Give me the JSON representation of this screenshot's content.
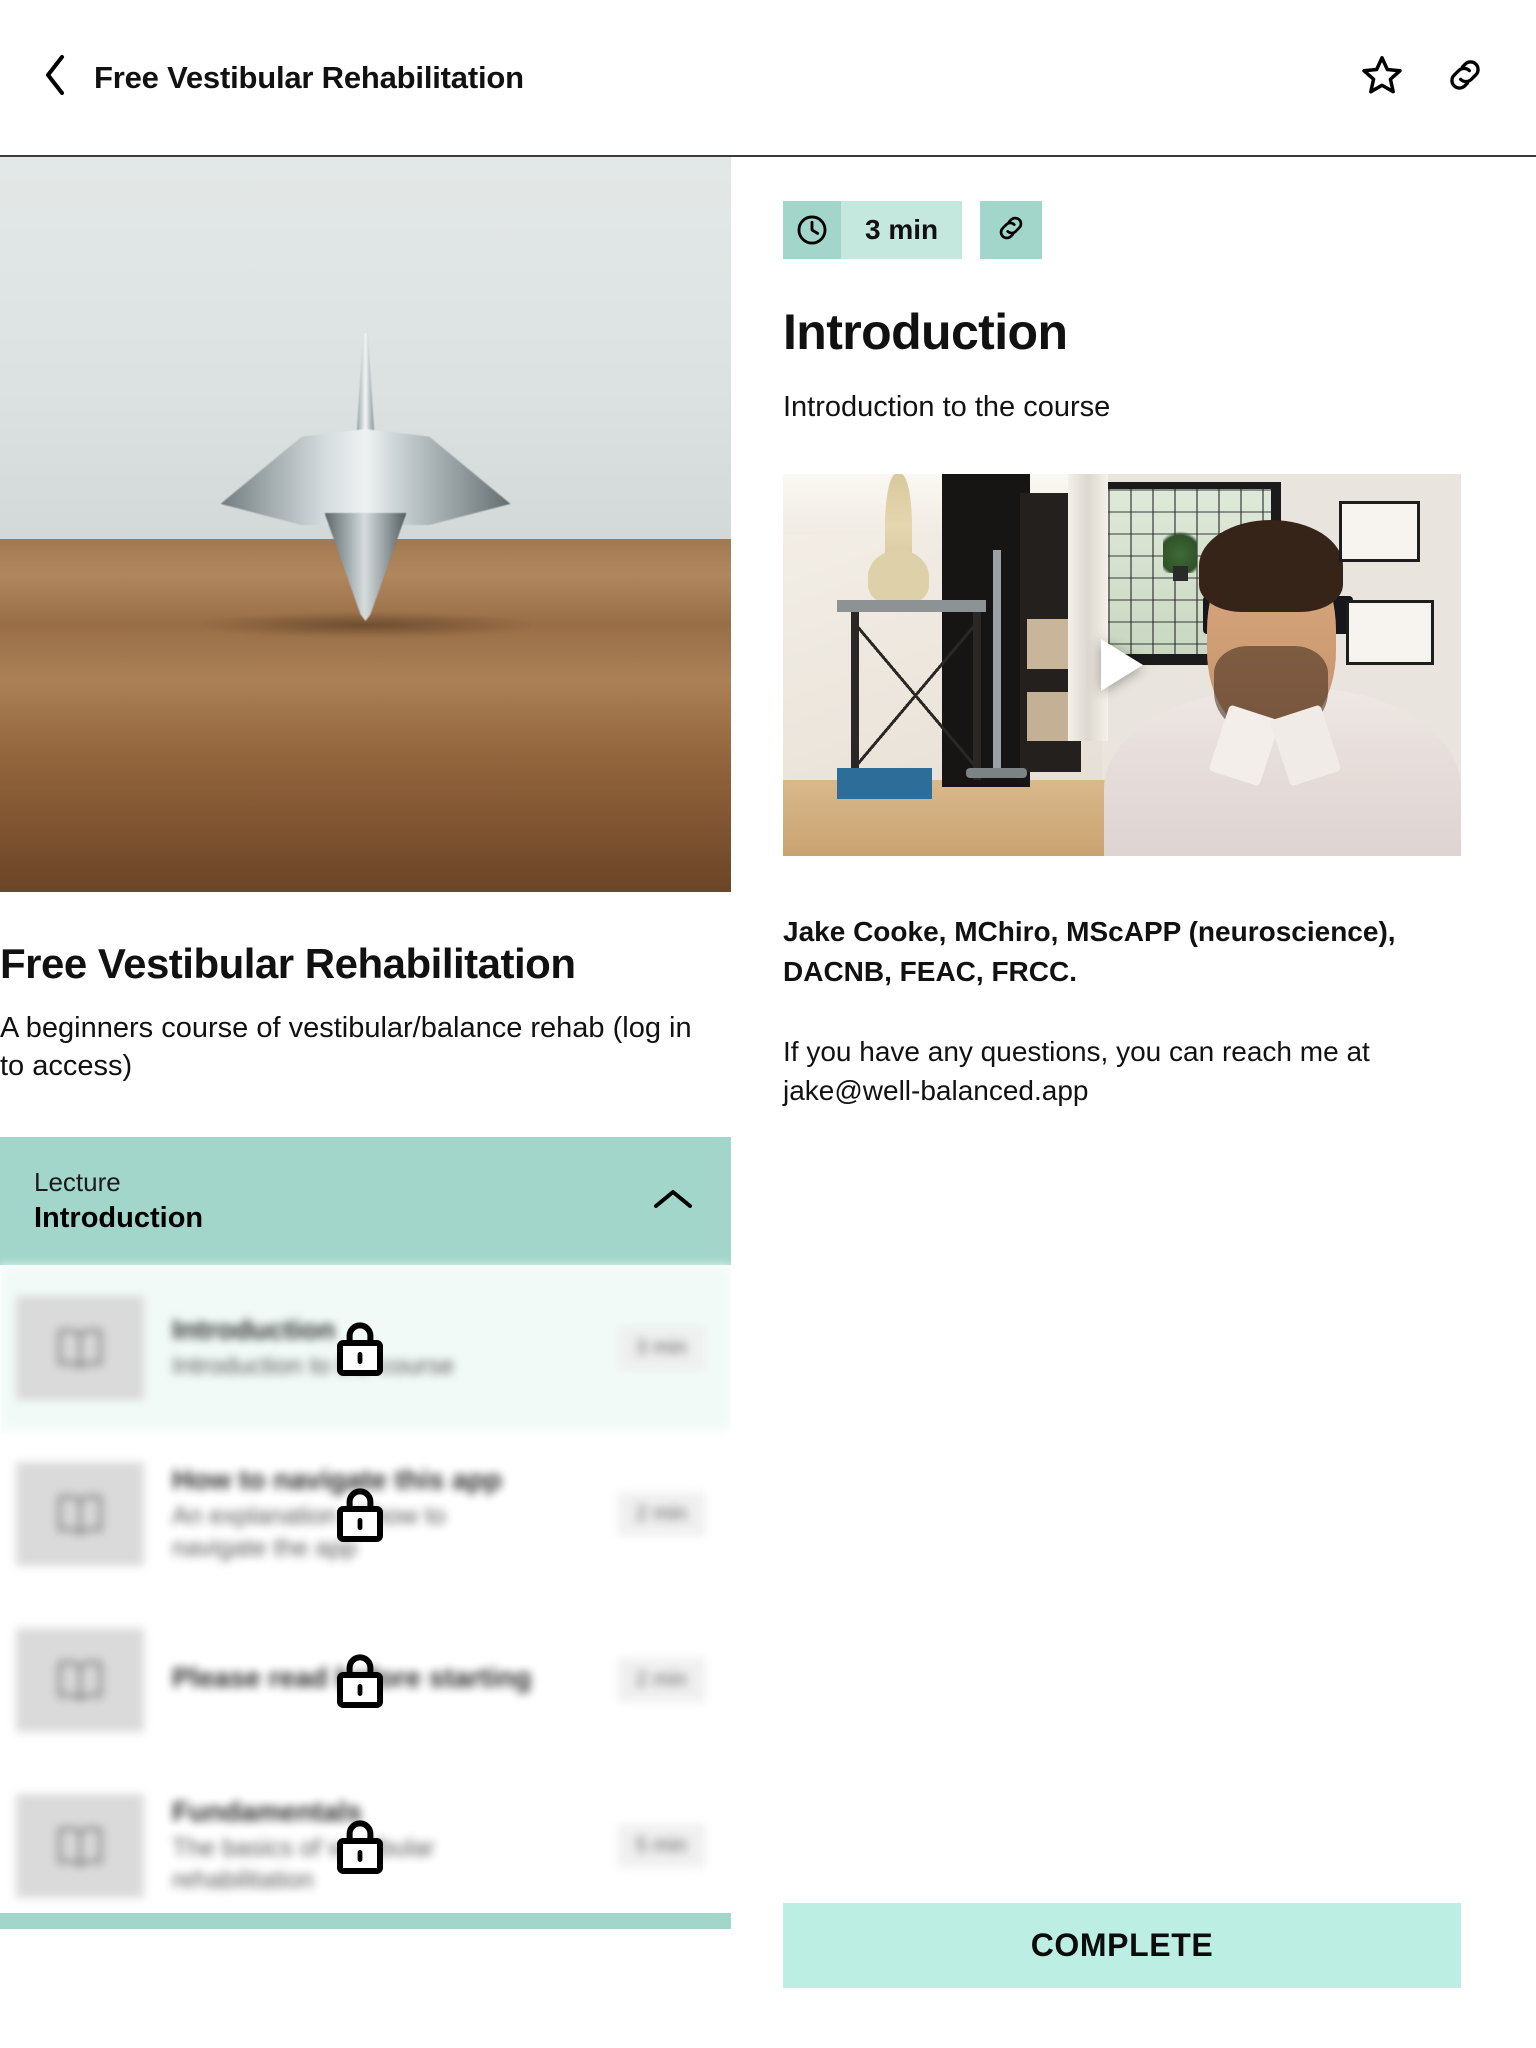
{
  "header": {
    "title": "Free Vestibular Rehabilitation",
    "back_icon": "chevron-left-icon",
    "favorite_icon": "star-icon",
    "share_icon": "link-icon"
  },
  "course": {
    "title": "Free Vestibular Rehabilitation",
    "description": "A beginners course of vestibular/balance rehab (log in to access)",
    "hero_alt": "spinning-top-on-wooden-table"
  },
  "section": {
    "kicker": "Lecture",
    "name": "Introduction",
    "toggle_icon": "chevron-up-icon",
    "expanded": true
  },
  "lessons": [
    {
      "title": "Introduction",
      "subtitle": "Introduction to the course",
      "duration": "3 min",
      "locked": true,
      "active": true,
      "icon": "book-icon",
      "lock_icon": "lock-icon"
    },
    {
      "title": "How to navigate this app",
      "subtitle": "An explanation of how to navigate the app",
      "duration": "2 min",
      "locked": true,
      "active": false,
      "icon": "book-icon",
      "lock_icon": "lock-icon"
    },
    {
      "title": "Please read before starting",
      "subtitle": "",
      "duration": "2 min",
      "locked": true,
      "active": false,
      "icon": "book-icon",
      "lock_icon": "lock-icon"
    },
    {
      "title": "Fundamentals",
      "subtitle": "The basics of vestibular rehabilitation",
      "duration": "5 min",
      "locked": true,
      "active": false,
      "icon": "book-icon",
      "lock_icon": "lock-icon"
    }
  ],
  "detail": {
    "duration": "3 min",
    "duration_icon": "clock-icon",
    "share_icon": "link-icon",
    "title": "Introduction",
    "blurb": "Introduction to the course",
    "video": {
      "play_icon": "play-icon",
      "alt": "presenter-seated-in-clinic-room"
    },
    "author": "Jake Cooke, MChiro, MScAPP (neuroscience), DACNB, FEAC, FRCC.",
    "contact": "If you have any questions, you can reach me at jake@well-balanced.app",
    "complete_label": "COMPLETE"
  },
  "colors": {
    "mint": "#A3D6CA",
    "mint_light": "#C5E8DE",
    "mint_button": "#BDEEE4",
    "active_row": "#F1FAF7"
  }
}
